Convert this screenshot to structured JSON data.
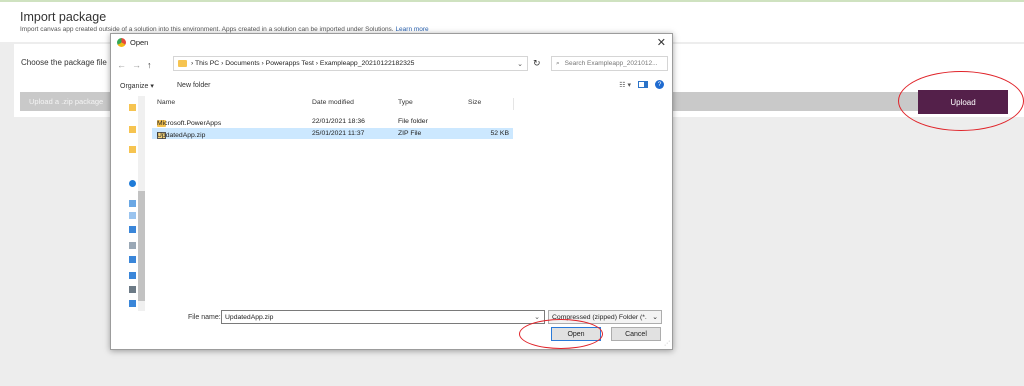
{
  "page": {
    "title": "Import package",
    "subtitle": "Import canvas app created outside of a solution into this environment. Apps created in a solution can be imported under Solutions.",
    "learn_more": "Learn more",
    "choose_label": "Choose the package file",
    "file_placeholder": "Upload a .zip package",
    "upload_label": "Upload"
  },
  "dialog": {
    "title": "Open",
    "close": "✕",
    "nav_back": "←",
    "nav_forward": "→",
    "nav_up": "↑",
    "path": "› This PC › Documents › Powerapps Test › Exampleapp_20210122182325",
    "search_placeholder": "Search Exampleapp_2021012...",
    "organize": "Organize ▾",
    "new_folder": "New folder",
    "columns": {
      "name": "Name",
      "date": "Date modified",
      "type": "Type",
      "size": "Size"
    },
    "rows": [
      {
        "name": "Microsoft.PowerApps",
        "date": "22/01/2021 18:36",
        "type": "File folder",
        "size": ""
      },
      {
        "name": "UpdatedApp.zip",
        "date": "25/01/2021 11:37",
        "type": "ZIP File",
        "size": "52 KB"
      }
    ],
    "file_name_label": "File name:",
    "file_name_value": "UpdatedApp.zip",
    "file_type": "Compressed (zipped) Folder (*.",
    "open_label": "Open",
    "cancel_label": "Cancel"
  },
  "colors": {
    "accent": "#54204a",
    "highlight": "#e0242a",
    "selection": "#cce8ff"
  }
}
